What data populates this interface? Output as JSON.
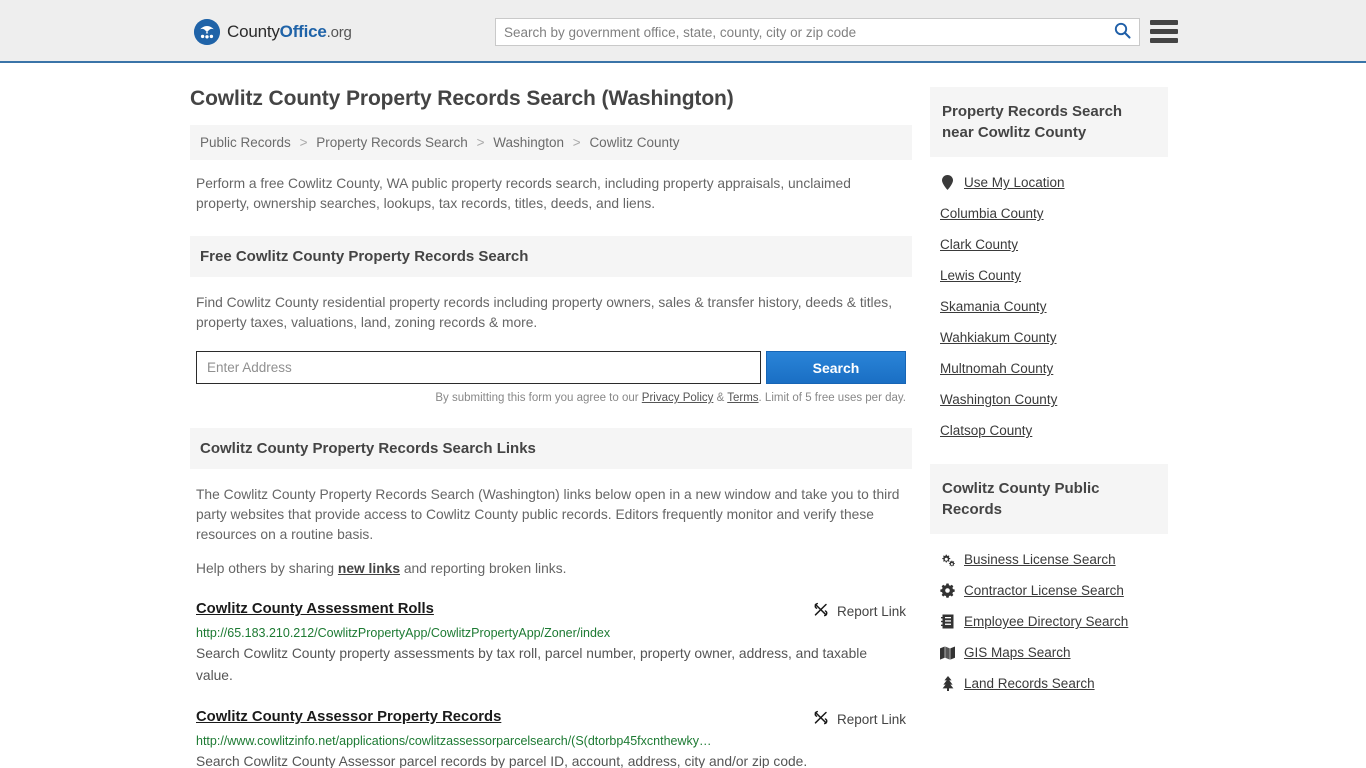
{
  "header": {
    "brand": {
      "part1": "County",
      "part2": "Office",
      "part3": ".org",
      "logo_icon": "eagle-stars-logo"
    },
    "search": {
      "placeholder": "Search by government office, state, county, city or zip code",
      "value": "",
      "icon": "search-icon"
    },
    "menu_icon": "hamburger-menu-icon"
  },
  "main": {
    "title": "Cowlitz County Property Records Search (Washington)",
    "breadcrumb": [
      {
        "label": "Public Records"
      },
      {
        "label": "Property Records Search"
      },
      {
        "label": "Washington"
      },
      {
        "label": "Cowlitz County"
      }
    ],
    "breadcrumb_separator": ">",
    "intro": "Perform a free Cowlitz County, WA public property records search, including property appraisals, unclaimed property, ownership searches, lookups, tax records, titles, deeds, and liens.",
    "free_search": {
      "heading": "Free Cowlitz County Property Records Search",
      "description": "Find Cowlitz County residential property records including property owners, sales & transfer history, deeds & titles, property taxes, valuations, land, zoning records & more.",
      "input_placeholder": "Enter Address",
      "input_value": "",
      "button_label": "Search",
      "disclaimer_prefix": "By submitting this form you agree to our ",
      "privacy_label": "Privacy Policy",
      "disclaimer_amp": " & ",
      "terms_label": "Terms",
      "disclaimer_suffix": ". Limit of 5 free uses per day."
    },
    "links_section": {
      "heading": "Cowlitz County Property Records Search Links",
      "paragraph": "The Cowlitz County Property Records Search (Washington) links below open in a new window and take you to third party websites that provide access to Cowlitz County public records. Editors frequently monitor and verify these resources on a routine basis.",
      "help_prefix": "Help others by sharing ",
      "help_link": "new links",
      "help_suffix": " and reporting broken links.",
      "report_label": "Report Link",
      "report_icon": "broken-link-icon",
      "results": [
        {
          "title": "Cowlitz County Assessment Rolls",
          "url": "http://65.183.210.212/CowlitzPropertyApp/CowlitzPropertyApp/Zoner/index",
          "description": "Search Cowlitz County property assessments by tax roll, parcel number, property owner, address, and taxable value."
        },
        {
          "title": "Cowlitz County Assessor Property Records",
          "url": "http://www.cowlitzinfo.net/applications/cowlitzassessorparcelsearch/(S(dtorbp45fxcnthewky…",
          "description": "Search Cowlitz County Assessor parcel records by parcel ID, account, address, city and/or zip code."
        }
      ]
    }
  },
  "sidebar": {
    "nearby": {
      "heading": "Property Records Search near Cowlitz County",
      "items": [
        {
          "label": "Use My Location",
          "icon": "map-pin-icon"
        },
        {
          "label": "Columbia County",
          "icon": ""
        },
        {
          "label": "Clark County",
          "icon": ""
        },
        {
          "label": "Lewis County",
          "icon": ""
        },
        {
          "label": "Skamania County",
          "icon": ""
        },
        {
          "label": "Wahkiakum County",
          "icon": ""
        },
        {
          "label": "Multnomah County",
          "icon": ""
        },
        {
          "label": "Washington County",
          "icon": ""
        },
        {
          "label": "Clatsop County",
          "icon": ""
        }
      ]
    },
    "public_records": {
      "heading": "Cowlitz County Public Records",
      "items": [
        {
          "label": "Business License Search",
          "icon": "cogs-icon"
        },
        {
          "label": "Contractor License Search",
          "icon": "cog-icon"
        },
        {
          "label": "Employee Directory Search",
          "icon": "address-book-icon"
        },
        {
          "label": "GIS Maps Search",
          "icon": "map-icon"
        },
        {
          "label": "Land Records Search",
          "icon": "tree-icon"
        }
      ]
    }
  },
  "colors": {
    "brand_blue": "#1f63a8",
    "header_bg": "#eeeeee",
    "header_border": "#3a74a8",
    "panel_bg": "#f5f5f5",
    "button_blue": "#1a6fc4",
    "url_green": "#1d7a33"
  }
}
